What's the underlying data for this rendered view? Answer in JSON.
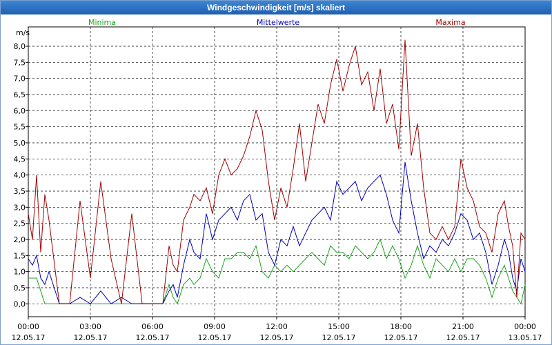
{
  "window": {
    "title": "Windgeschwindigkeit [m/s] skaliert"
  },
  "chart_data": {
    "type": "line",
    "ylabel": "m/s",
    "ylim": [
      -0.4,
      8.6
    ],
    "yticks": [
      "0,0",
      "0,5",
      "1,0",
      "1,5",
      "2,0",
      "2,5",
      "3,0",
      "3,5",
      "4,0",
      "4,5",
      "5,0",
      "5,5",
      "6,0",
      "6,5",
      "7,0",
      "7,5",
      "8,0"
    ],
    "xlim": [
      0,
      24
    ],
    "xticks": [
      {
        "time": "00:00",
        "date": "12.05.17"
      },
      {
        "time": "03:00",
        "date": "12.05.17"
      },
      {
        "time": "06:00",
        "date": "12.05.17"
      },
      {
        "time": "09:00",
        "date": "12.05.17"
      },
      {
        "time": "12:00",
        "date": "12.05.17"
      },
      {
        "time": "15:00",
        "date": "12.05.17"
      },
      {
        "time": "18:00",
        "date": "12.05.17"
      },
      {
        "time": "21:00",
        "date": "12.05.17"
      },
      {
        "time": "00:00",
        "date": "13.05.17"
      }
    ],
    "grid": true,
    "series": [
      {
        "name": "Minima",
        "color": "#1aa31a",
        "x": [
          0,
          0.2,
          0.4,
          0.6,
          0.8,
          1.0,
          1.5,
          2.0,
          2.5,
          3.0,
          3.5,
          4.0,
          4.5,
          5.0,
          5.5,
          6.0,
          6.5,
          6.8,
          7.0,
          7.2,
          7.5,
          7.8,
          8.0,
          8.3,
          8.6,
          8.9,
          9.2,
          9.5,
          9.8,
          10.1,
          10.4,
          10.7,
          11.0,
          11.3,
          11.6,
          11.9,
          12.2,
          12.5,
          12.8,
          13.1,
          13.4,
          13.7,
          14.0,
          14.3,
          14.6,
          14.9,
          15.2,
          15.5,
          15.8,
          16.1,
          16.4,
          16.7,
          17.0,
          17.3,
          17.6,
          17.9,
          18.2,
          18.5,
          18.8,
          19.1,
          19.4,
          19.7,
          20.0,
          20.3,
          20.6,
          20.9,
          21.2,
          21.5,
          21.8,
          22.1,
          22.4,
          22.7,
          23.0,
          23.2,
          23.4,
          23.6,
          23.8,
          24.0
        ],
        "y": [
          0.8,
          0.8,
          0.8,
          0.4,
          0.0,
          0.0,
          0.0,
          0.0,
          0.0,
          0.0,
          0.0,
          0.0,
          0.0,
          0.0,
          0.0,
          0.0,
          0.0,
          0.6,
          0.2,
          0.0,
          0.6,
          0.8,
          0.6,
          0.8,
          1.4,
          1.0,
          0.8,
          1.4,
          1.4,
          1.6,
          1.6,
          1.4,
          1.8,
          1.0,
          0.8,
          1.2,
          1.0,
          1.2,
          1.0,
          1.2,
          1.4,
          1.6,
          1.4,
          1.2,
          1.8,
          1.6,
          1.6,
          1.4,
          1.8,
          1.6,
          1.4,
          1.6,
          2.0,
          1.4,
          1.8,
          1.4,
          0.8,
          1.2,
          1.8,
          1.2,
          0.8,
          1.4,
          1.2,
          1.0,
          1.4,
          1.0,
          1.4,
          1.4,
          1.2,
          0.8,
          0.2,
          0.8,
          1.2,
          0.8,
          0.4,
          0.2,
          0.0,
          0.6
        ]
      },
      {
        "name": "Mittelwerte",
        "color": "#0000c0",
        "x": [
          0,
          0.2,
          0.4,
          0.6,
          0.8,
          1.0,
          1.5,
          2.0,
          2.5,
          3.0,
          3.5,
          4.0,
          4.5,
          5.0,
          5.5,
          6.0,
          6.5,
          6.8,
          7.0,
          7.2,
          7.5,
          7.8,
          8.0,
          8.3,
          8.6,
          8.9,
          9.2,
          9.5,
          9.8,
          10.1,
          10.4,
          10.7,
          11.0,
          11.3,
          11.6,
          11.9,
          12.2,
          12.5,
          12.8,
          13.1,
          13.4,
          13.7,
          14.0,
          14.3,
          14.6,
          14.9,
          15.2,
          15.5,
          15.8,
          16.1,
          16.4,
          16.7,
          17.0,
          17.3,
          17.6,
          17.9,
          18.2,
          18.5,
          18.8,
          19.1,
          19.4,
          19.7,
          20.0,
          20.3,
          20.6,
          20.9,
          21.2,
          21.5,
          21.8,
          22.1,
          22.4,
          22.7,
          23.0,
          23.2,
          23.4,
          23.6,
          23.8,
          24.0
        ],
        "y": [
          1.4,
          1.2,
          1.5,
          0.8,
          0.6,
          1.0,
          0.0,
          0.0,
          0.2,
          0.0,
          0.4,
          0.0,
          0.2,
          0.0,
          0.0,
          0.0,
          0.0,
          0.4,
          0.6,
          0.2,
          1.2,
          2.0,
          1.6,
          1.4,
          2.8,
          2.0,
          2.6,
          2.8,
          3.0,
          2.6,
          3.2,
          3.4,
          2.6,
          2.8,
          1.6,
          1.2,
          2.0,
          1.8,
          2.4,
          1.8,
          2.2,
          2.6,
          2.8,
          3.0,
          2.6,
          3.8,
          3.4,
          3.6,
          3.8,
          3.2,
          3.6,
          3.8,
          4.0,
          3.4,
          2.6,
          2.2,
          4.4,
          3.2,
          2.2,
          1.4,
          1.8,
          1.6,
          2.0,
          1.8,
          2.2,
          2.8,
          2.6,
          2.0,
          2.2,
          1.6,
          0.6,
          1.2,
          2.0,
          1.6,
          0.8,
          0.4,
          1.4,
          1.0
        ]
      },
      {
        "name": "Maxima",
        "color": "#a00000",
        "x": [
          0,
          0.2,
          0.4,
          0.6,
          0.8,
          1.0,
          1.5,
          2.0,
          2.5,
          3.0,
          3.5,
          4.0,
          4.5,
          5.0,
          5.5,
          6.0,
          6.5,
          6.8,
          7.0,
          7.2,
          7.5,
          7.8,
          8.0,
          8.3,
          8.6,
          8.9,
          9.2,
          9.5,
          9.8,
          10.1,
          10.4,
          10.7,
          11.0,
          11.3,
          11.6,
          11.9,
          12.2,
          12.5,
          12.8,
          13.1,
          13.4,
          13.7,
          14.0,
          14.3,
          14.6,
          14.9,
          15.2,
          15.5,
          15.8,
          16.1,
          16.4,
          16.7,
          17.0,
          17.3,
          17.6,
          17.9,
          18.2,
          18.5,
          18.8,
          19.1,
          19.4,
          19.7,
          20.0,
          20.3,
          20.6,
          20.9,
          21.2,
          21.5,
          21.8,
          22.1,
          22.4,
          22.7,
          23.0,
          23.2,
          23.4,
          23.6,
          23.8,
          24.0
        ],
        "y": [
          2.8,
          2.0,
          4.0,
          1.6,
          3.4,
          2.6,
          0.0,
          0.0,
          3.2,
          0.8,
          3.8,
          1.4,
          0.0,
          2.8,
          0.0,
          0.0,
          0.0,
          1.8,
          1.2,
          1.0,
          2.6,
          3.0,
          3.4,
          3.2,
          3.6,
          2.8,
          4.0,
          4.5,
          4.0,
          4.2,
          4.6,
          5.2,
          6.0,
          5.4,
          3.8,
          2.6,
          3.6,
          3.0,
          4.2,
          5.6,
          3.8,
          5.0,
          6.2,
          5.6,
          6.8,
          7.6,
          6.6,
          7.4,
          8.0,
          6.8,
          7.2,
          6.0,
          7.3,
          5.6,
          6.2,
          4.8,
          8.2,
          4.6,
          5.6,
          3.6,
          2.2,
          2.0,
          2.4,
          2.0,
          2.4,
          4.5,
          3.6,
          3.2,
          2.4,
          2.2,
          1.6,
          2.8,
          3.2,
          2.4,
          1.8,
          0.2,
          2.2,
          2.0
        ]
      }
    ]
  }
}
